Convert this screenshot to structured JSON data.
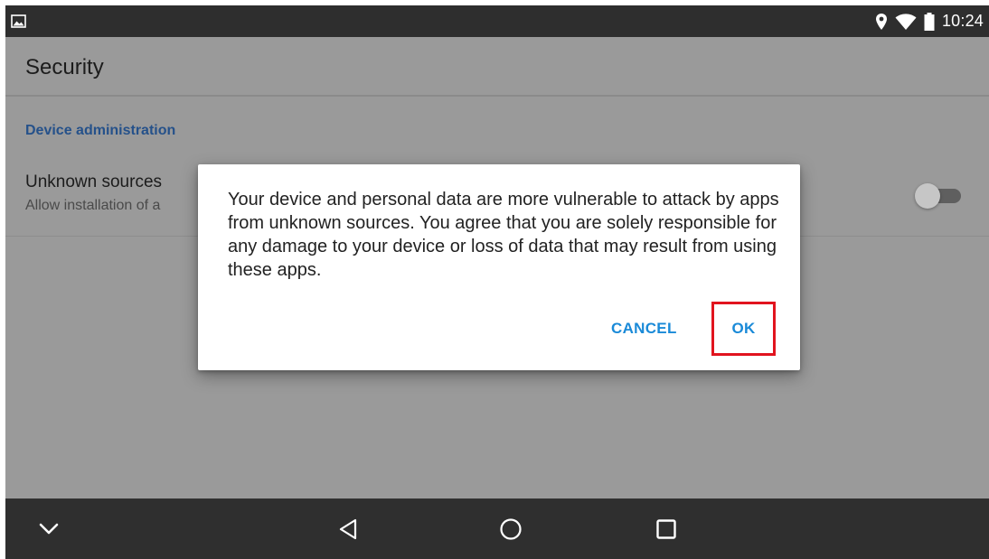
{
  "status_bar": {
    "notification_icon": "image-icon",
    "icons": [
      "location-icon",
      "wifi-icon",
      "battery-icon"
    ],
    "time": "10:24"
  },
  "action_bar": {
    "title": "Security"
  },
  "settings": {
    "section_header": "Device administration",
    "unknown_sources": {
      "title": "Unknown sources",
      "summary": "Allow installation of a",
      "switch_on": false
    }
  },
  "dialog": {
    "message": "Your device and personal data are more vulnerable to attack by apps from unknown sources. You agree that you are solely responsible for any damage to your device or loss of data that may result from using these apps.",
    "cancel_label": "CANCEL",
    "ok_label": "OK"
  },
  "nav_bar": {
    "buttons": [
      "chevron-down-icon",
      "back-icon",
      "home-icon",
      "recents-icon"
    ]
  },
  "colors": {
    "accent": "#1a8ad8",
    "highlight_box": "#e1141e",
    "section_header": "#25518a",
    "status_bar": "#2e2e2e",
    "nav_bar": "#2f2f2f",
    "dim_background": "#9a9a9a"
  }
}
